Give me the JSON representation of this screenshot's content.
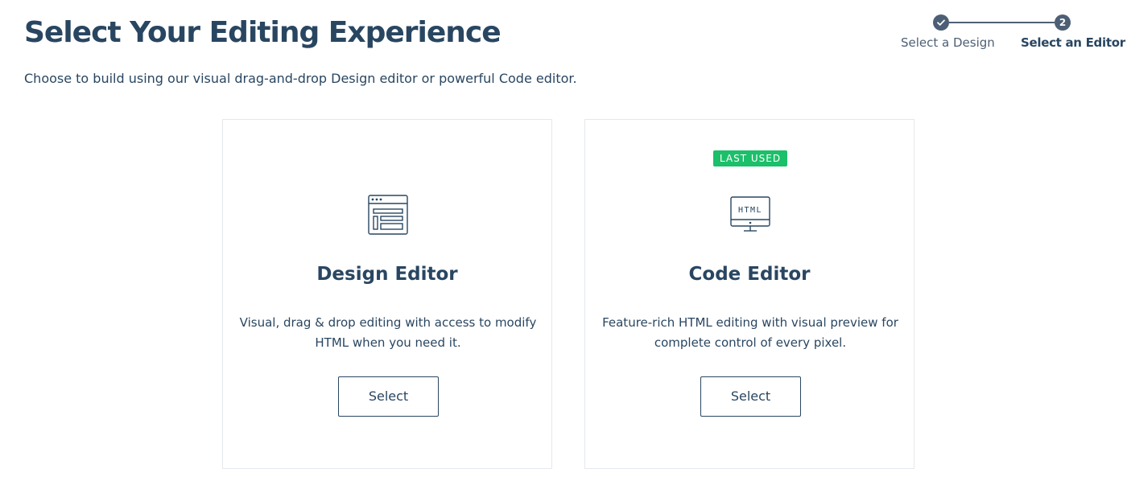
{
  "header": {
    "title": "Select Your Editing Experience",
    "subtitle": "Choose to build using our visual drag-and-drop Design editor or powerful Code editor."
  },
  "stepper": {
    "steps": [
      {
        "label": "Select a Design",
        "status": "completed",
        "icon": "check-icon"
      },
      {
        "label": "Select an Editor",
        "status": "current",
        "number": "2"
      }
    ]
  },
  "cards": [
    {
      "icon": "browser-layout-icon",
      "title": "Design Editor",
      "description": "Visual, drag & drop editing with access to modify HTML when you need it.",
      "button_label": "Select"
    },
    {
      "badge": "LAST USED",
      "icon": "html-monitor-icon",
      "icon_text": "HTML",
      "title": "Code Editor",
      "description": "Feature-rich HTML editing with visual preview for complete control of every pixel.",
      "button_label": "Select"
    }
  ],
  "colors": {
    "text": "#294661",
    "muted": "#4d5f74",
    "badge": "#1cbf6a",
    "border": "#e4e8ec"
  }
}
